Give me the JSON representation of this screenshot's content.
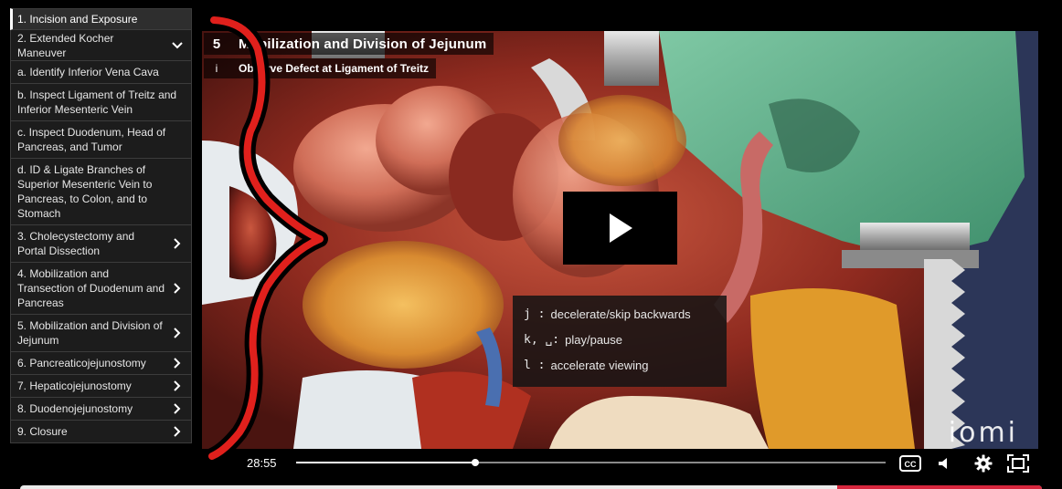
{
  "sidebar": {
    "chapters": [
      {
        "label": "1. Incision and Exposure",
        "active": true,
        "chevron": "none",
        "h": 24
      },
      {
        "label": "2. Extended Kocher Maneuver",
        "active": false,
        "chevron": "chevron-down",
        "h": 34
      },
      {
        "label": "a. Identify Inferior Vena Cava",
        "active": false,
        "chevron": "none",
        "h": 25
      },
      {
        "label": "b. Inspect Ligament of Treitz and Inferior Mesenteric Vein",
        "active": false,
        "chevron": "none",
        "h": 41
      },
      {
        "label": "c. Inspect Duodenum, Head of Pancreas, and Tumor",
        "active": false,
        "chevron": "none",
        "h": 41
      },
      {
        "label": "d. ID & Ligate Branches of Superior Mesenteric Vein to Pancreas, to Colon, and to Stomach",
        "active": false,
        "chevron": "none",
        "h": 73
      },
      {
        "label": "3. Cholecystectomy and Portal Dissection",
        "active": false,
        "chevron": "chevron-right",
        "h": 41
      },
      {
        "label": "4. Mobilization and Transection of Duodenum and Pancreas",
        "active": false,
        "chevron": "chevron-right",
        "h": 57
      },
      {
        "label": "5. Mobilization and Division of Jejunum",
        "active": false,
        "chevron": "chevron-right",
        "h": 41
      },
      {
        "label": "6. Pancreaticojejunostomy",
        "active": false,
        "chevron": "chevron-right",
        "h": 25
      },
      {
        "label": "7. Hepaticojejunostomy",
        "active": false,
        "chevron": "chevron-right",
        "h": 25
      },
      {
        "label": "8. Duodenojejunostomy",
        "active": false,
        "chevron": "chevron-right",
        "h": 25
      },
      {
        "label": "9. Closure",
        "active": false,
        "chevron": "chevron-right",
        "h": 25
      }
    ]
  },
  "video": {
    "chapter_number": "5",
    "chapter_title": "Mobilization and Division of Jejunum",
    "sub_number": "i",
    "sub_title": "Observe Defect at Ligament of Treitz",
    "play_icon": "play-icon",
    "watermark": "iomi",
    "keyboard_help": [
      {
        "key": "j :",
        "desc": "decelerate/skip backwards"
      },
      {
        "key": "k, ␣:",
        "desc": "play/pause"
      },
      {
        "key": "l :",
        "desc": "accelerate viewing"
      }
    ]
  },
  "controls": {
    "time": "28:55",
    "progress": 0.304,
    "icons": [
      "closed-captions-icon",
      "volume-icon",
      "settings-gear-icon",
      "fullscreen-icon"
    ]
  },
  "colors": {
    "annotation_red": "#e0201c",
    "sidebar_bg": "#1c1c1c",
    "accent_red": "#d7263d"
  }
}
